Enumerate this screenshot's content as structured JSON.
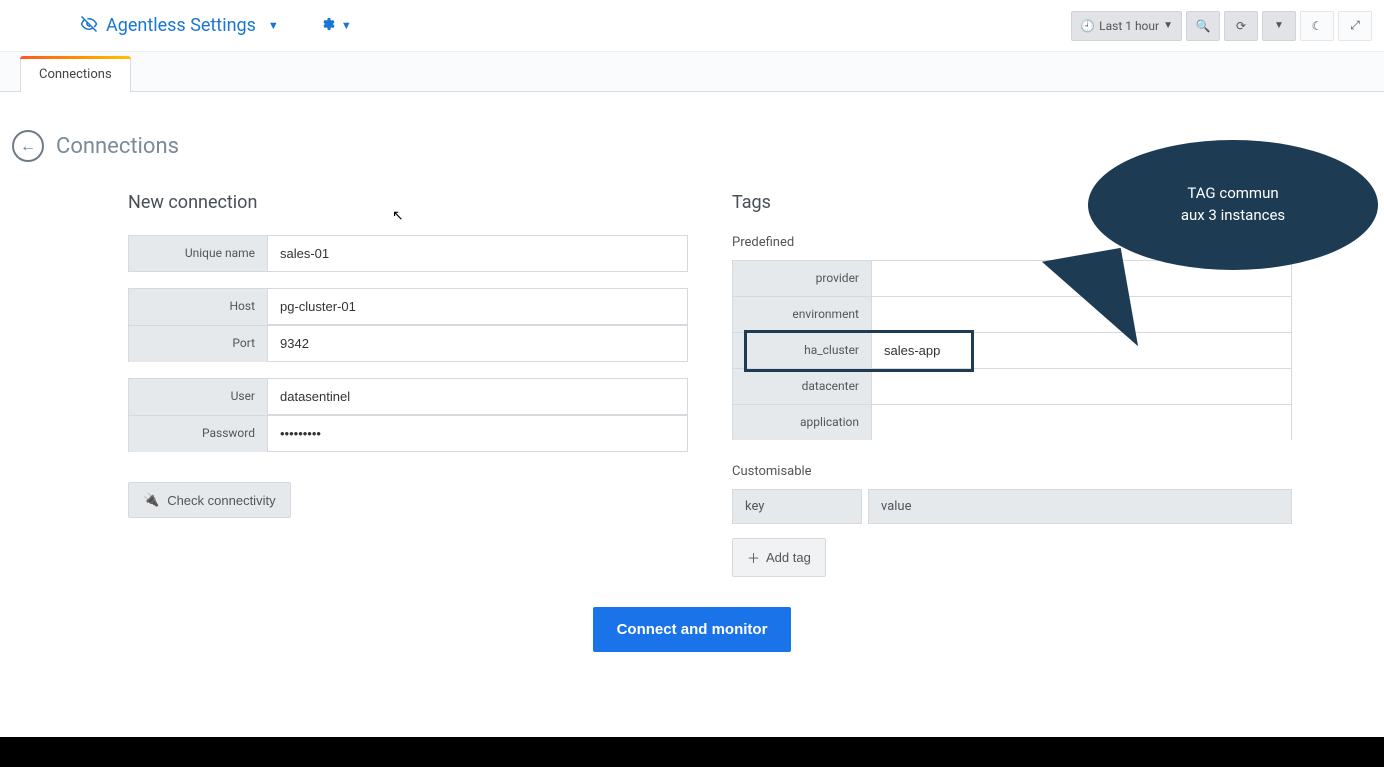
{
  "topbar": {
    "brand": "Agentless Settings",
    "timeRange": "Last 1 hour"
  },
  "tabs": {
    "connections": "Connections"
  },
  "pageTitle": "Connections",
  "newConnection": {
    "title": "New connection",
    "labels": {
      "uniqueName": "Unique name",
      "host": "Host",
      "port": "Port",
      "user": "User",
      "password": "Password"
    },
    "values": {
      "uniqueName": "sales-01",
      "host": "pg-cluster-01",
      "port": "9342",
      "user": "datasentinel",
      "password": "•••••••••"
    },
    "checkBtn": "Check connectivity"
  },
  "tags": {
    "title": "Tags",
    "predefined": {
      "heading": "Predefined",
      "labels": {
        "provider": "provider",
        "environment": "environment",
        "ha_cluster": "ha_cluster",
        "datacenter": "datacenter",
        "application": "application"
      },
      "values": {
        "provider": "",
        "environment": "",
        "ha_cluster": "sales-app",
        "datacenter": "",
        "application": ""
      }
    },
    "customisable": {
      "heading": "Customisable",
      "keyLabel": "key",
      "valueLabel": "value",
      "addBtn": "Add tag"
    }
  },
  "connectBtn": "Connect and monitor",
  "callout": {
    "line1": "TAG commun",
    "line2": "aux 3 instances"
  }
}
